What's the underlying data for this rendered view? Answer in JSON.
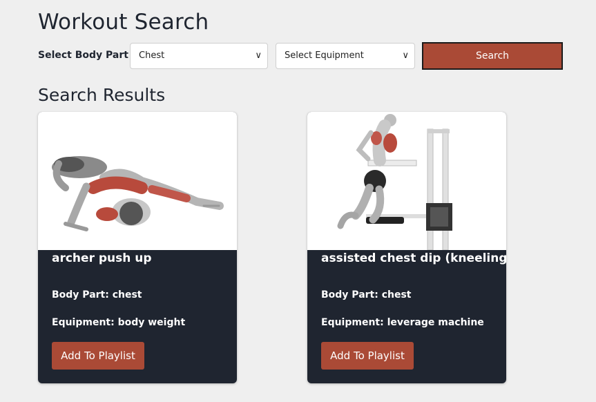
{
  "header": {
    "title": "Workout Search"
  },
  "search": {
    "body_part_label": "Select Body Part",
    "body_part_value": "Chest",
    "equipment_value": "Select Equipment",
    "search_label": "Search"
  },
  "results": {
    "title": "Search Results",
    "cards": [
      {
        "name": "archer push up",
        "body_part": "Body Part: chest",
        "equipment": "Equipment: body weight",
        "button": "Add To Playlist"
      },
      {
        "name": "assisted chest dip (kneeling)",
        "body_part": "Body Part: chest",
        "equipment": "Equipment: leverage machine",
        "button": "Add To Playlist"
      }
    ]
  },
  "colors": {
    "accent": "#aa4a36",
    "card_bg": "#1f2530",
    "page_bg": "#efefef"
  },
  "icons": {
    "dropdown": "chevron-down-icon"
  }
}
